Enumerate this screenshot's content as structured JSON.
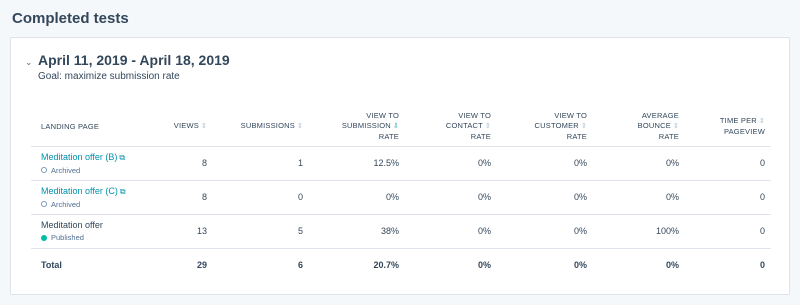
{
  "page": {
    "title": "Completed tests"
  },
  "test": {
    "date_range": "April 11, 2019 - April 18, 2019",
    "goal": "Goal: maximize submission rate"
  },
  "icons": {
    "chevron": "chevron-down-icon",
    "sort": "sort-arrows-icon",
    "external": "external-link-icon",
    "status": "status-dot-icon"
  },
  "colors": {
    "link": "#0091ae",
    "published": "#00bda5",
    "border": "#dfe3eb",
    "text": "#33475b"
  },
  "table": {
    "columns": [
      {
        "l1": "LANDING PAGE",
        "l2": "",
        "l3": ""
      },
      {
        "l1": "VIEWS",
        "l2": "",
        "l3": ""
      },
      {
        "l1": "SUBMISSIONS",
        "l2": "",
        "l3": ""
      },
      {
        "l1": "VIEW TO",
        "l2": "SUBMISSION",
        "l3": "RATE"
      },
      {
        "l1": "VIEW TO",
        "l2": "CONTACT",
        "l3": "RATE"
      },
      {
        "l1": "VIEW TO",
        "l2": "CUSTOMER",
        "l3": "RATE"
      },
      {
        "l1": "AVERAGE",
        "l2": "BOUNCE",
        "l3": "RATE"
      },
      {
        "l1": "TIME PER",
        "l2": "PAGEVIEW",
        "l3": ""
      }
    ],
    "rows": [
      {
        "name": "Meditation offer (B)",
        "status": "Archived",
        "views": "8",
        "submissions": "1",
        "submission_rate": "12.5%",
        "contact_rate": "0%",
        "customer_rate": "0%",
        "bounce_rate": "0%",
        "time_per_pageview": "0"
      },
      {
        "name": "Meditation offer (C)",
        "status": "Archived",
        "views": "8",
        "submissions": "0",
        "submission_rate": "0%",
        "contact_rate": "0%",
        "customer_rate": "0%",
        "bounce_rate": "0%",
        "time_per_pageview": "0"
      },
      {
        "name": "Meditation offer",
        "status": "Published",
        "views": "13",
        "submissions": "5",
        "submission_rate": "38%",
        "contact_rate": "0%",
        "customer_rate": "0%",
        "bounce_rate": "100%",
        "time_per_pageview": "0"
      }
    ],
    "total": {
      "label": "Total",
      "views": "29",
      "submissions": "6",
      "submission_rate": "20.7%",
      "contact_rate": "0%",
      "customer_rate": "0%",
      "bounce_rate": "0%",
      "time_per_pageview": "0"
    }
  }
}
